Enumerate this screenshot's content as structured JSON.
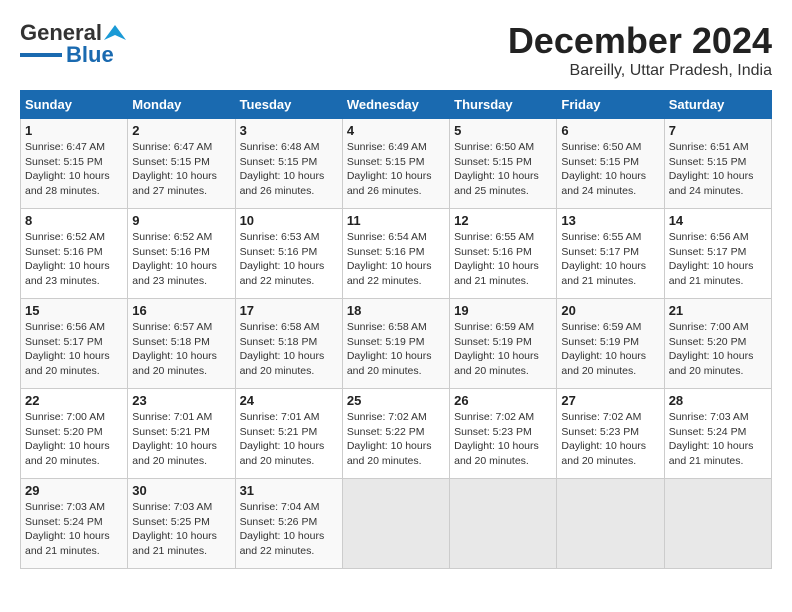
{
  "logo": {
    "line1": "General",
    "line2": "Blue"
  },
  "title": "December 2024",
  "subtitle": "Bareilly, Uttar Pradesh, India",
  "weekdays": [
    "Sunday",
    "Monday",
    "Tuesday",
    "Wednesday",
    "Thursday",
    "Friday",
    "Saturday"
  ],
  "weeks": [
    [
      {
        "day": "1",
        "info": "Sunrise: 6:47 AM\nSunset: 5:15 PM\nDaylight: 10 hours\nand 28 minutes."
      },
      {
        "day": "2",
        "info": "Sunrise: 6:47 AM\nSunset: 5:15 PM\nDaylight: 10 hours\nand 27 minutes."
      },
      {
        "day": "3",
        "info": "Sunrise: 6:48 AM\nSunset: 5:15 PM\nDaylight: 10 hours\nand 26 minutes."
      },
      {
        "day": "4",
        "info": "Sunrise: 6:49 AM\nSunset: 5:15 PM\nDaylight: 10 hours\nand 26 minutes."
      },
      {
        "day": "5",
        "info": "Sunrise: 6:50 AM\nSunset: 5:15 PM\nDaylight: 10 hours\nand 25 minutes."
      },
      {
        "day": "6",
        "info": "Sunrise: 6:50 AM\nSunset: 5:15 PM\nDaylight: 10 hours\nand 24 minutes."
      },
      {
        "day": "7",
        "info": "Sunrise: 6:51 AM\nSunset: 5:15 PM\nDaylight: 10 hours\nand 24 minutes."
      }
    ],
    [
      {
        "day": "8",
        "info": "Sunrise: 6:52 AM\nSunset: 5:16 PM\nDaylight: 10 hours\nand 23 minutes."
      },
      {
        "day": "9",
        "info": "Sunrise: 6:52 AM\nSunset: 5:16 PM\nDaylight: 10 hours\nand 23 minutes."
      },
      {
        "day": "10",
        "info": "Sunrise: 6:53 AM\nSunset: 5:16 PM\nDaylight: 10 hours\nand 22 minutes."
      },
      {
        "day": "11",
        "info": "Sunrise: 6:54 AM\nSunset: 5:16 PM\nDaylight: 10 hours\nand 22 minutes."
      },
      {
        "day": "12",
        "info": "Sunrise: 6:55 AM\nSunset: 5:16 PM\nDaylight: 10 hours\nand 21 minutes."
      },
      {
        "day": "13",
        "info": "Sunrise: 6:55 AM\nSunset: 5:17 PM\nDaylight: 10 hours\nand 21 minutes."
      },
      {
        "day": "14",
        "info": "Sunrise: 6:56 AM\nSunset: 5:17 PM\nDaylight: 10 hours\nand 21 minutes."
      }
    ],
    [
      {
        "day": "15",
        "info": "Sunrise: 6:56 AM\nSunset: 5:17 PM\nDaylight: 10 hours\nand 20 minutes."
      },
      {
        "day": "16",
        "info": "Sunrise: 6:57 AM\nSunset: 5:18 PM\nDaylight: 10 hours\nand 20 minutes."
      },
      {
        "day": "17",
        "info": "Sunrise: 6:58 AM\nSunset: 5:18 PM\nDaylight: 10 hours\nand 20 minutes."
      },
      {
        "day": "18",
        "info": "Sunrise: 6:58 AM\nSunset: 5:19 PM\nDaylight: 10 hours\nand 20 minutes."
      },
      {
        "day": "19",
        "info": "Sunrise: 6:59 AM\nSunset: 5:19 PM\nDaylight: 10 hours\nand 20 minutes."
      },
      {
        "day": "20",
        "info": "Sunrise: 6:59 AM\nSunset: 5:19 PM\nDaylight: 10 hours\nand 20 minutes."
      },
      {
        "day": "21",
        "info": "Sunrise: 7:00 AM\nSunset: 5:20 PM\nDaylight: 10 hours\nand 20 minutes."
      }
    ],
    [
      {
        "day": "22",
        "info": "Sunrise: 7:00 AM\nSunset: 5:20 PM\nDaylight: 10 hours\nand 20 minutes."
      },
      {
        "day": "23",
        "info": "Sunrise: 7:01 AM\nSunset: 5:21 PM\nDaylight: 10 hours\nand 20 minutes."
      },
      {
        "day": "24",
        "info": "Sunrise: 7:01 AM\nSunset: 5:21 PM\nDaylight: 10 hours\nand 20 minutes."
      },
      {
        "day": "25",
        "info": "Sunrise: 7:02 AM\nSunset: 5:22 PM\nDaylight: 10 hours\nand 20 minutes."
      },
      {
        "day": "26",
        "info": "Sunrise: 7:02 AM\nSunset: 5:23 PM\nDaylight: 10 hours\nand 20 minutes."
      },
      {
        "day": "27",
        "info": "Sunrise: 7:02 AM\nSunset: 5:23 PM\nDaylight: 10 hours\nand 20 minutes."
      },
      {
        "day": "28",
        "info": "Sunrise: 7:03 AM\nSunset: 5:24 PM\nDaylight: 10 hours\nand 21 minutes."
      }
    ],
    [
      {
        "day": "29",
        "info": "Sunrise: 7:03 AM\nSunset: 5:24 PM\nDaylight: 10 hours\nand 21 minutes."
      },
      {
        "day": "30",
        "info": "Sunrise: 7:03 AM\nSunset: 5:25 PM\nDaylight: 10 hours\nand 21 minutes."
      },
      {
        "day": "31",
        "info": "Sunrise: 7:04 AM\nSunset: 5:26 PM\nDaylight: 10 hours\nand 22 minutes."
      },
      {
        "day": "",
        "info": ""
      },
      {
        "day": "",
        "info": ""
      },
      {
        "day": "",
        "info": ""
      },
      {
        "day": "",
        "info": ""
      }
    ]
  ]
}
